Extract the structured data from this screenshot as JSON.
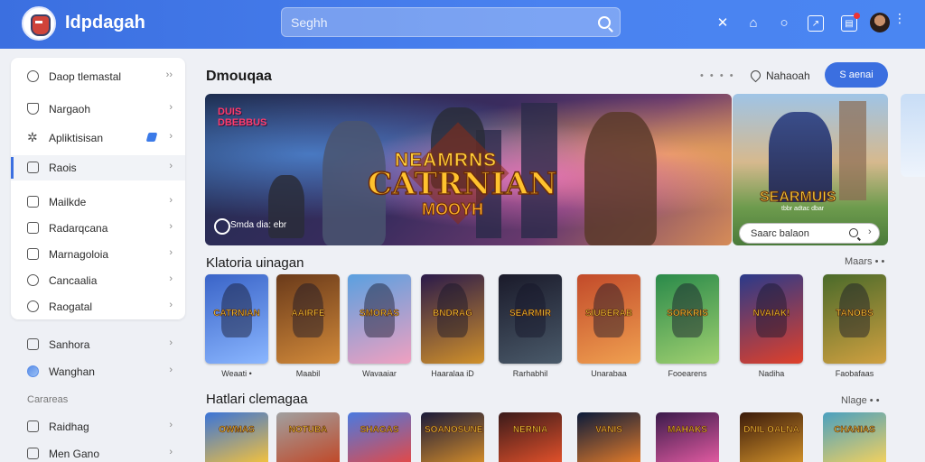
{
  "app": {
    "title": "Idpdagah"
  },
  "search": {
    "placeholder": "Seghh"
  },
  "header_icons": [
    "tools-icon",
    "home-icon",
    "chat-icon",
    "inbox-icon",
    "notifications-icon"
  ],
  "sidebar": {
    "group1": [
      {
        "label": "Daop tlemastal",
        "icon": "user-icon"
      },
      {
        "label": "Nargaoh",
        "icon": "shield-icon"
      },
      {
        "label": "Apliktisisan",
        "icon": "star-icon"
      },
      {
        "label": "Raois",
        "icon": "grid-icon",
        "active": true
      }
    ],
    "group2": [
      {
        "label": "Mailkde",
        "icon": "lock-icon"
      },
      {
        "label": "Radarqcana",
        "icon": "list-icon"
      },
      {
        "label": "Marnagoloia",
        "icon": "list-icon"
      },
      {
        "label": "Cancaalia",
        "icon": "circle-icon"
      },
      {
        "label": "Raogatal",
        "icon": "circle-icon"
      }
    ],
    "group3": [
      {
        "label": "Sanhora",
        "icon": "calendar-icon"
      },
      {
        "label": "Wanghan",
        "icon": "globe-icon"
      }
    ],
    "section_label": "Carareas",
    "group4": [
      {
        "label": "Raidhag",
        "icon": "list-icon"
      },
      {
        "label": "Men Gano",
        "icon": "box-icon"
      }
    ]
  },
  "featured": {
    "title": "Dmouqaa",
    "more_dots": "• • • •",
    "wishlist_label": "Nahaoah",
    "primary_label": "S aenai",
    "hero": {
      "badge_line1": "DUIS",
      "badge_line2": "DBEBBUS",
      "logo_line1": "NEAMRNS",
      "logo_line2": "CATRNIAN",
      "logo_line3": "MOOYH",
      "caption": "Smda dia: ebr"
    },
    "side_banner": {
      "title": "SEARMUIS",
      "subtitle": "tbbr adtac dbar",
      "search_label": "Saarc balaon"
    }
  },
  "row1": {
    "title": "Klatoria uinagan",
    "more": "Maars • •",
    "cards": [
      {
        "title": "CATRNIAN",
        "label": "Weaati •",
        "colors": [
          "#3a64c8",
          "#8ab6ff"
        ]
      },
      {
        "title": "AAIRFE",
        "label": "Maabil",
        "colors": [
          "#6a3a1a",
          "#d28a3a"
        ]
      },
      {
        "title": "SMORAS",
        "label": "Wavaaiar",
        "colors": [
          "#5aa0e0",
          "#f0a0c0"
        ]
      },
      {
        "title": "BNDRAG",
        "label": "Haaralaa iD",
        "colors": [
          "#2a1a4a",
          "#d0902a"
        ]
      },
      {
        "title": "SEARMIR",
        "label": "Rarhabhil",
        "colors": [
          "#1a1a2a",
          "#4a5a6a"
        ]
      },
      {
        "title": "SIUBERAB",
        "label": "Unarabaa",
        "colors": [
          "#c24a2a",
          "#f0a050"
        ]
      },
      {
        "title": "SORKRIS",
        "label": "Fooearens",
        "colors": [
          "#2a8a4a",
          "#a0d070"
        ]
      },
      {
        "title": "NVAIAK!",
        "label": "Nadiha",
        "colors": [
          "#2a3a8a",
          "#e0402a"
        ]
      },
      {
        "title": "TANOBS",
        "label": "Faobafaas",
        "colors": [
          "#4a6a2a",
          "#d0a040"
        ]
      }
    ]
  },
  "row2": {
    "title": "Hatlari clemagaa",
    "more": "Nlage • •",
    "cards": [
      {
        "title": "OWMAS",
        "colors": [
          "#3a74d8",
          "#f0c040"
        ]
      },
      {
        "title": "NOTUBA",
        "colors": [
          "#a0a0a0",
          "#c04a2a"
        ]
      },
      {
        "title": "SHAGAS",
        "colors": [
          "#4a7ae0",
          "#e04a4a"
        ]
      },
      {
        "title": "SOANOSUNE",
        "colors": [
          "#1a1a3a",
          "#d08a2a"
        ]
      },
      {
        "title": "NERNIA",
        "colors": [
          "#3a1a1a",
          "#e0502a"
        ]
      },
      {
        "title": "VANIS",
        "colors": [
          "#0a1a3a",
          "#e07a2a"
        ]
      },
      {
        "title": "MAHAKS",
        "colors": [
          "#3a1a4a",
          "#e05aa0"
        ]
      },
      {
        "title": "DNIL OALNA",
        "colors": [
          "#3a1a0a",
          "#d0902a"
        ]
      },
      {
        "title": "CHANIAS",
        "colors": [
          "#4aa0c0",
          "#f0d060"
        ]
      }
    ]
  }
}
